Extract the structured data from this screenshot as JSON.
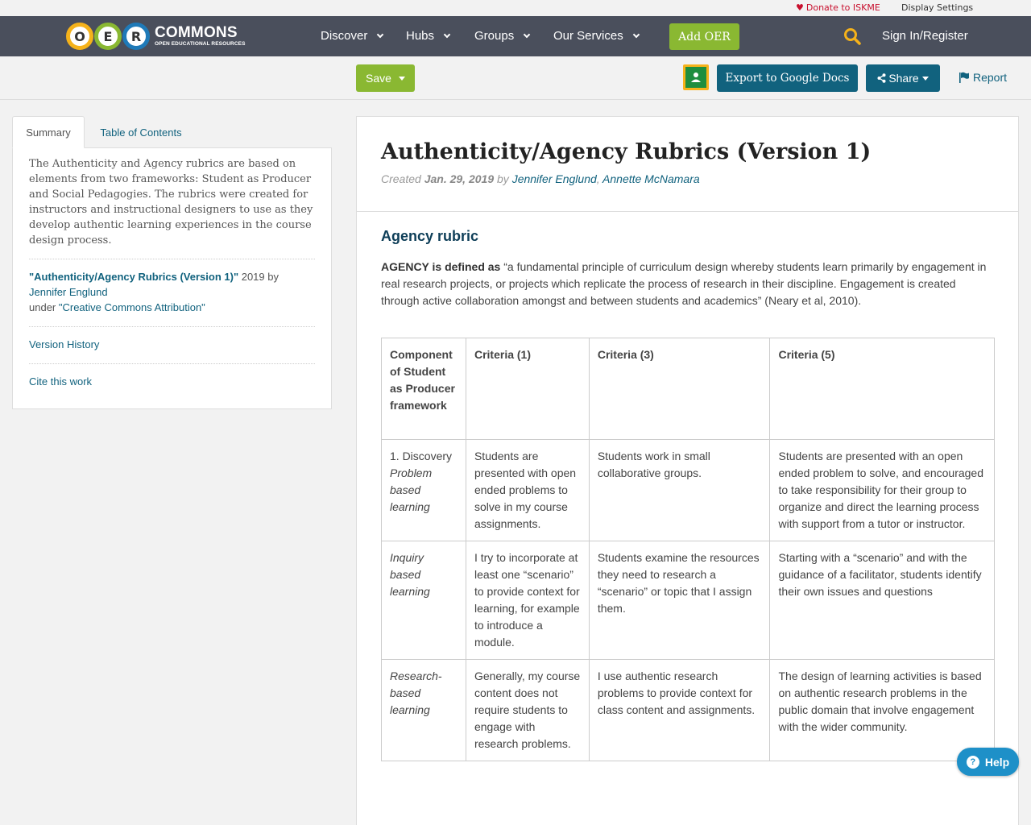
{
  "utility": {
    "donate": "Donate to ISKME",
    "display_settings": "Display Settings"
  },
  "nav": {
    "logo_letters": [
      "O",
      "E",
      "R"
    ],
    "logo_word": "COMMONS",
    "logo_sub": "OPEN EDUCATIONAL RESOURCES",
    "items": [
      "Discover",
      "Hubs",
      "Groups",
      "Our Services"
    ],
    "add_oer": "Add OER",
    "signin": "Sign In/Register"
  },
  "toolbar": {
    "save": "Save",
    "export": "Export to Google Docs",
    "share": "Share",
    "report": "Report"
  },
  "sidebar": {
    "tabs": [
      "Summary",
      "Table of Contents"
    ],
    "summary": "The Authenticity and Agency rubrics are based on elements from two frameworks: Student as Producer and Social Pedagogies. The rubrics were created for instructors and instructional designers to use as they develop authentic learning experiences in the course design process.",
    "attrib_title": "\"Authenticity/Agency Rubrics (Version 1)\"",
    "attrib_year": " 2019 by",
    "attrib_author": "Jennifer Englund",
    "attrib_under": "under ",
    "attrib_license": "\"Creative Commons Attribution\"",
    "version_history": "Version History",
    "cite": "Cite this work"
  },
  "main": {
    "title": "Authenticity/Agency Rubrics (Version 1)",
    "created_label": "Created ",
    "created_date": "Jan. 29, 2019",
    "by_label": " by ",
    "author1": "Jennifer Englund",
    "sep": ", ",
    "author2": "Annette McNamara",
    "section_heading": "Agency rubric",
    "intro_bold": "AGENCY is defined as",
    "intro_text": " “a fundamental principle of curriculum design whereby students learn primarily by engagement in real research projects, or projects which replicate the process of research in their discipline. Engagement is created through active collaboration amongst and between students and academics” (Neary et al, 2010).",
    "table": {
      "headers": [
        "Component of Student as Producer framework",
        "Criteria (1)",
        "Criteria (3)",
        "Criteria (5)"
      ],
      "rows": [
        {
          "c1_plain": "1. Discovery",
          "c1_italic": "Problem based learning",
          "c2": "Students are presented with open ended problems to solve in my course assignments.",
          "c3": "Students work in small collaborative groups.",
          "c4": "Students are presented with an open ended problem to solve, and encouraged to take responsibility for their group to organize and direct the learning process with support from a tutor or instructor."
        },
        {
          "c1_plain": "",
          "c1_italic": "Inquiry based learning",
          "c2": "I try to incorporate at least one “scenario” to provide context for learning, for example to introduce a module.",
          "c3": "Students examine the resources they need to research a “scenario” or topic that I assign them.",
          "c4": "Starting with a “scenario” and with the guidance of a facilitator, students identify their own issues and questions"
        },
        {
          "c1_plain": "",
          "c1_italic": "Research-based learning",
          "c2": "Generally, my course content does not require students to engage with research problems.",
          "c3": "I use authentic research problems to provide context for class content and assignments.",
          "c4": "The design of learning activities is based on authentic research problems in the public domain that involve engagement with the wider community."
        }
      ]
    }
  },
  "help": "Help",
  "colors": {
    "nav_bg": "#4a4f5c",
    "green": "#8ab832",
    "teal": "#11627e",
    "donate_red": "#c8102e",
    "help_blue": "#1e90c8"
  }
}
